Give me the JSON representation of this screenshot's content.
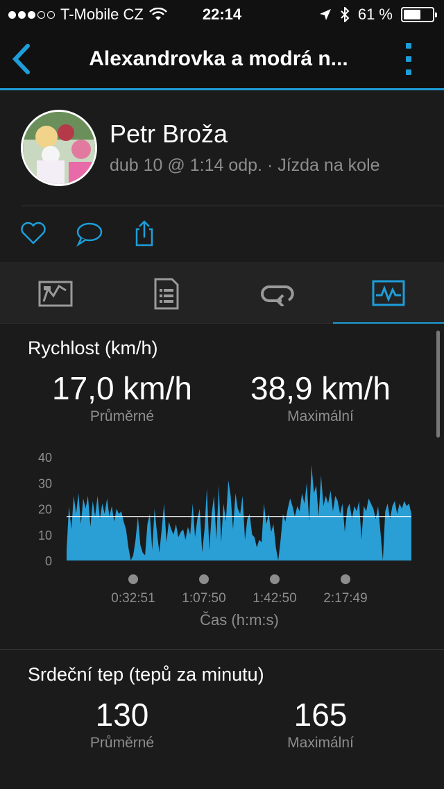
{
  "status_bar": {
    "carrier": "T-Mobile CZ",
    "time": "22:14",
    "battery": "61 %",
    "battery_level": 0.61
  },
  "nav": {
    "title": "Alexandrovka a modrá n..."
  },
  "activity": {
    "user_name": "Petr Broža",
    "meta": "dub 10 @ 1:14 odp. · Jízda na kole"
  },
  "speed": {
    "title": "Rychlost (km/h)",
    "avg_value": "17,0 km/h",
    "avg_label": "Průměrné",
    "max_value": "38,9 km/h",
    "max_label": "Maximální"
  },
  "heart_rate": {
    "title": "Srdeční tep (tepů za minutu)",
    "avg_value": "130",
    "avg_label": "Průměrné",
    "max_value": "165",
    "max_label": "Maximální"
  },
  "colors": {
    "accent": "#1e9ed9",
    "background": "#1b1b1b",
    "area_fill": "#2a9fd6"
  },
  "chart_data": {
    "type": "area",
    "y_ticks": [
      "40",
      "30",
      "20",
      "10",
      "0"
    ],
    "ylim": [
      0,
      40
    ],
    "x_ticks": [
      "0:32:51",
      "1:07:50",
      "1:42:50",
      "2:17:49"
    ],
    "xlabel": "Čas (h:m:s)",
    "average_line": 17.0,
    "series": [
      {
        "values": [
          4,
          21,
          12,
          25,
          18,
          26,
          14,
          24,
          20,
          25,
          13,
          23,
          17,
          25,
          16,
          22,
          18,
          24,
          17,
          21,
          15,
          20,
          18,
          19,
          15,
          12,
          5,
          0,
          2,
          8,
          17,
          6,
          3,
          2,
          14,
          18,
          4,
          20,
          11,
          3,
          12,
          22,
          7,
          15,
          12,
          10,
          14,
          9,
          11,
          12,
          8,
          13,
          10,
          22,
          9,
          16,
          20,
          3,
          12,
          28,
          4,
          18,
          25,
          8,
          29,
          7,
          22,
          15,
          31,
          25,
          12,
          26,
          20,
          18,
          25,
          8,
          16,
          18,
          10,
          9,
          5,
          8,
          7,
          22,
          14,
          18,
          11,
          14,
          5,
          0,
          8,
          18,
          15,
          20,
          24,
          21,
          17,
          21,
          19,
          26,
          22,
          30,
          15,
          37,
          26,
          29,
          17,
          33,
          21,
          25,
          22,
          27,
          19,
          25,
          23,
          18,
          22,
          11,
          20,
          22,
          16,
          21,
          19,
          23,
          8,
          21,
          19,
          24,
          22,
          20,
          16,
          21,
          11,
          0,
          19,
          22,
          16,
          21,
          23,
          18,
          22,
          20,
          23,
          21,
          22,
          18
        ]
      }
    ]
  }
}
